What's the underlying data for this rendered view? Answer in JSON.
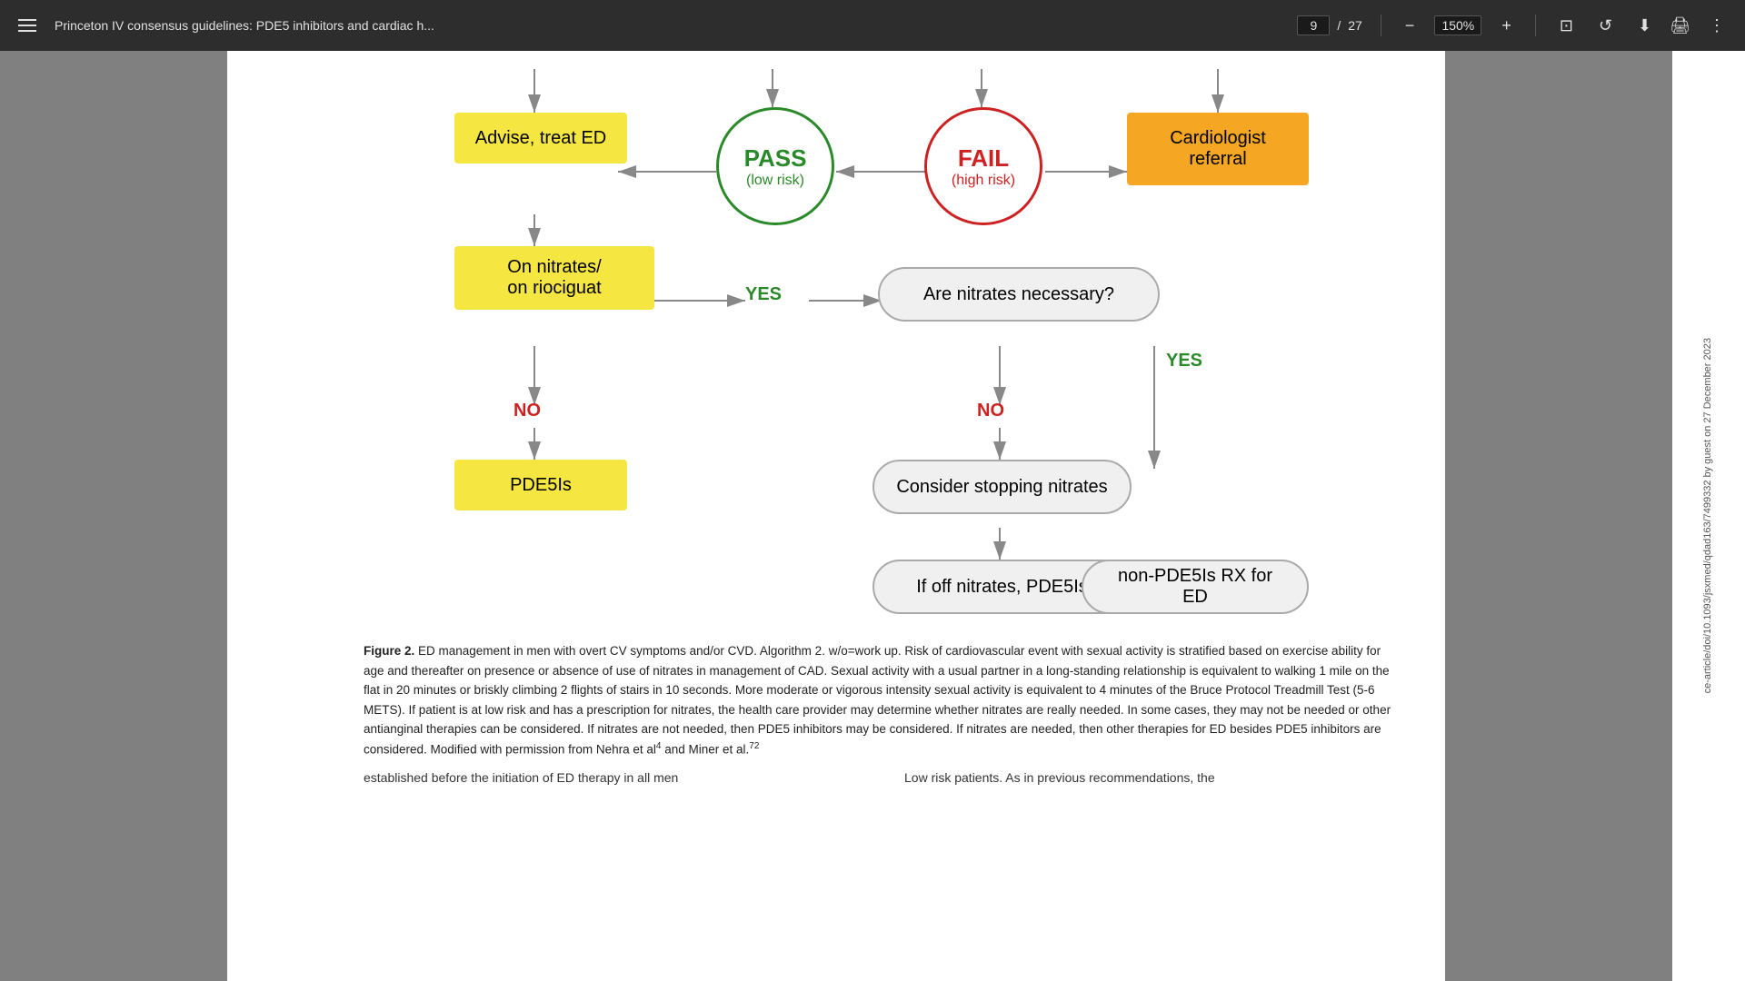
{
  "toolbar": {
    "menu_label": "Menu",
    "title": "Princeton IV consensus guidelines: PDE5 inhibitors and cardiac h...",
    "page_current": "9",
    "page_total": "27",
    "zoom": "150%",
    "download_label": "Download",
    "print_label": "Print",
    "more_label": "More options"
  },
  "flowchart": {
    "nodes": {
      "advise_treat_ed": "Advise, treat ED",
      "pass": "PASS",
      "pass_sub": "(low risk)",
      "fail": "FAIL",
      "fail_sub": "(high risk)",
      "cardiologist_referral": "Cardiologist referral",
      "on_nitrates": "On nitrates/\non riociguat",
      "yes1": "YES",
      "are_nitrates_necessary": "Are nitrates necessary?",
      "no1": "NO",
      "no2": "NO",
      "yes2": "YES",
      "pde5is": "PDE5Is",
      "consider_stopping": "Consider stopping nitrates",
      "if_off_nitrates": "If off nitrates, PDE5Is",
      "non_pde5is": "non-PDE5Is RX for ED"
    },
    "caption": {
      "label": "Figure 2.",
      "text": " ED management in men with overt CV symptoms and/or CVD. Algorithm 2. w/o=work up. Risk of cardiovascular event with sexual activity is stratified based on exercise ability for age and thereafter on presence or absence of use of nitrates in management of CAD. Sexual activity with a usual partner in a long-standing relationship is equivalent to walking 1 mile on the flat in 20 minutes or briskly climbing 2 flights of stairs in 10 seconds. More moderate or vigorous intensity sexual activity is equivalent to 4 minutes of the Bruce Protocol Treadmill Test (5-6 METS). If patient is at low risk and has a prescription for nitrates, the health care provider may determine whether nitrates are really needed. In some cases, they may not be needed or other antianginal therapies can be considered. If nitrates are not needed, then PDE5 inhibitors may be considered. If nitrates are needed, then other therapies for ED besides PDE5 inhibitors are considered. Modified with permission from Nehra et al",
      "ref1": "4",
      "text2": " and Miner et al.",
      "ref2": "72"
    },
    "bottom_left": "established before the initiation of ED therapy in all men",
    "bottom_right": "Low risk patients. As in previous recommendations, the"
  },
  "sidebar": {
    "text": "ce-article/doi/10.1093/jsxmed/qdad163/7499332 by guest on 27 December 2023"
  }
}
